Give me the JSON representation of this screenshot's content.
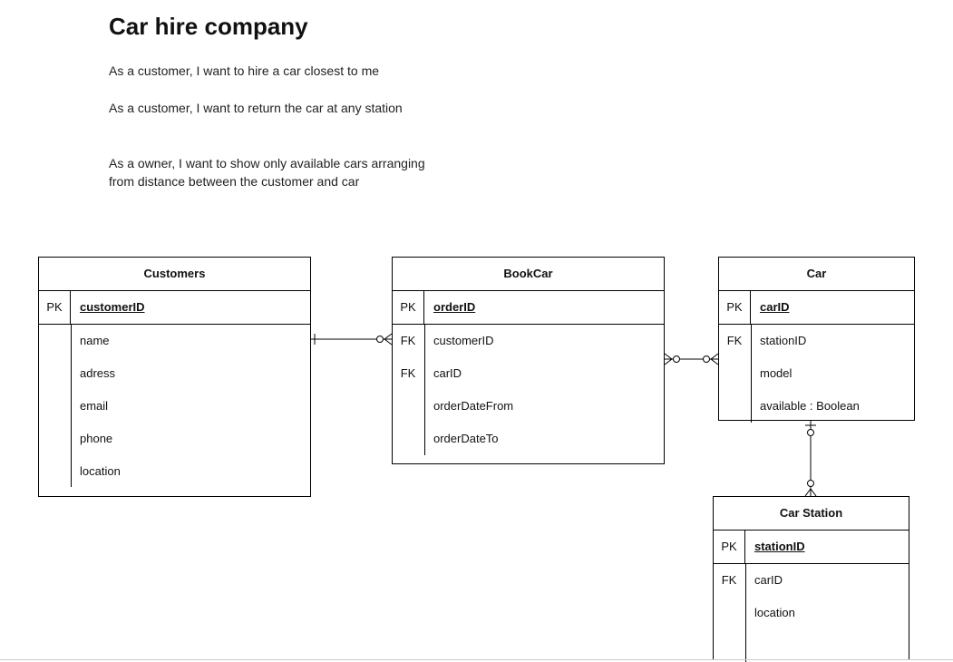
{
  "title": "Car hire company",
  "stories": [
    "As a customer, I want to hire a car closest to me",
    "As a customer, I want to return the car at any station",
    "As a owner, I want to show only available cars arranging from distance between the customer and car"
  ],
  "entities": {
    "customers": {
      "name": "Customers",
      "pk_label": "PK",
      "pk_field": "customerID",
      "fields": [
        {
          "key": "",
          "name": "name"
        },
        {
          "key": "",
          "name": "adress"
        },
        {
          "key": "",
          "name": "email"
        },
        {
          "key": "",
          "name": "phone"
        },
        {
          "key": "",
          "name": "location"
        }
      ]
    },
    "bookcar": {
      "name": "BookCar",
      "pk_label": "PK",
      "pk_field": "orderID",
      "fields": [
        {
          "key": "FK",
          "name": "customerID"
        },
        {
          "key": "FK",
          "name": "carID"
        },
        {
          "key": "",
          "name": "orderDateFrom"
        },
        {
          "key": "",
          "name": "orderDateTo"
        }
      ]
    },
    "car": {
      "name": "Car",
      "pk_label": "PK",
      "pk_field": "carID",
      "fields": [
        {
          "key": "FK",
          "name": "stationID"
        },
        {
          "key": "",
          "name": "model"
        },
        {
          "key": "",
          "name": "available  :  Boolean"
        }
      ]
    },
    "carstation": {
      "name": "Car Station",
      "pk_label": "PK",
      "pk_field": "stationID",
      "fields": [
        {
          "key": "FK",
          "name": "carID"
        },
        {
          "key": "",
          "name": "location"
        }
      ]
    }
  },
  "relationships": [
    {
      "from": "Customers",
      "to": "BookCar",
      "from_end": "one",
      "to_end": "zero-or-many"
    },
    {
      "from": "BookCar",
      "to": "Car",
      "from_end": "zero-or-many",
      "to_end": "zero-or-many"
    },
    {
      "from": "Car",
      "to": "Car Station",
      "from_end": "one-or-zero",
      "to_end": "zero-or-many"
    }
  ]
}
